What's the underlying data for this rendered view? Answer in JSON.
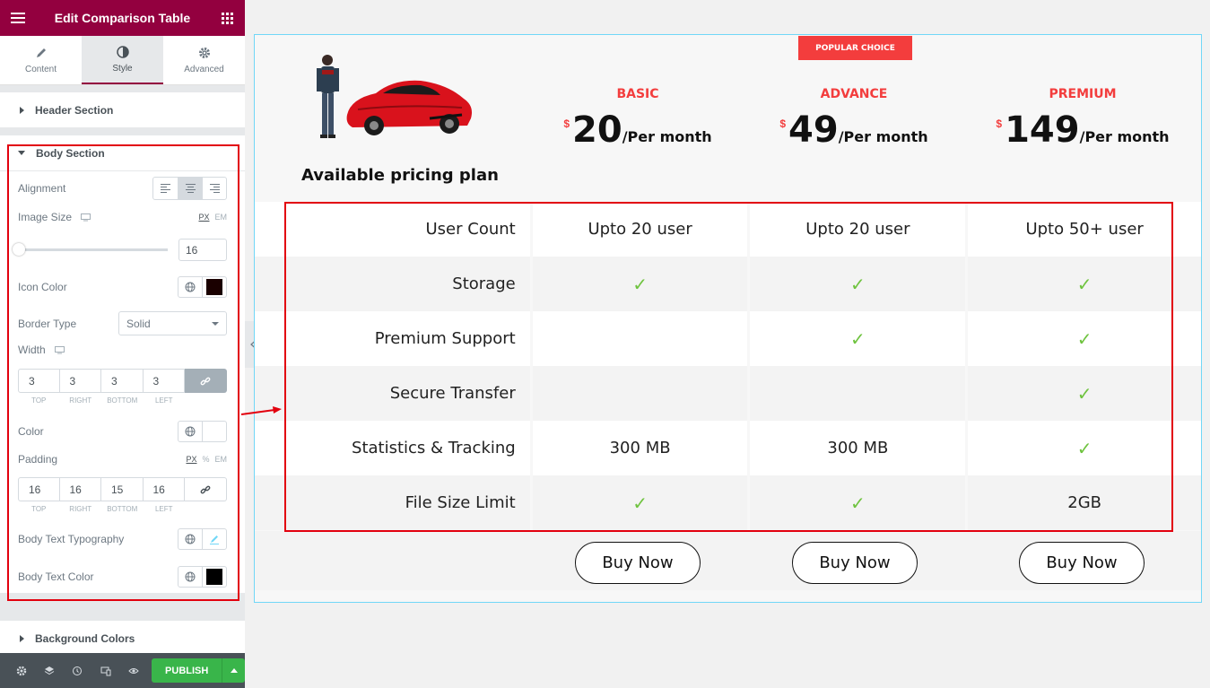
{
  "sidebar": {
    "title": "Edit Comparison Table",
    "tabs": [
      {
        "label": "Content"
      },
      {
        "label": "Style"
      },
      {
        "label": "Advanced"
      }
    ],
    "header_section": "Header Section",
    "body_section": "Body Section",
    "alignment_label": "Alignment",
    "image_size_label": "Image Size",
    "image_size_units": [
      "PX",
      "EM"
    ],
    "image_size_value": "16",
    "icon_color_label": "Icon Color",
    "icon_color": "#1a0000",
    "border_type_label": "Border Type",
    "border_type_value": "Solid",
    "width_label": "Width",
    "width_values": [
      "3",
      "3",
      "3",
      "3"
    ],
    "dim_labels": [
      "TOP",
      "RIGHT",
      "BOTTOM",
      "LEFT"
    ],
    "color_label": "Color",
    "padding_label": "Padding",
    "padding_units": [
      "PX",
      "%",
      "EM"
    ],
    "padding_values": [
      "16",
      "16",
      "15",
      "16"
    ],
    "body_text_typography_label": "Body Text Typography",
    "body_text_color_label": "Body Text Color",
    "body_text_color": "#000000",
    "background_colors": "Background Colors",
    "publish": "PUBLISH"
  },
  "table": {
    "badge": "POPULAR CHOICE",
    "heading": "Available pricing plan",
    "plans": [
      {
        "name": "BASIC",
        "currency": "$",
        "amount": "20",
        "period": "/Per month"
      },
      {
        "name": "ADVANCE",
        "currency": "$",
        "amount": "49",
        "period": "/Per month"
      },
      {
        "name": "PREMIUM",
        "currency": "$",
        "amount": "149",
        "period": "/Per month"
      }
    ],
    "rows": [
      {
        "feature": "User Count",
        "values": [
          "Upto 20 user",
          "Upto 20 user",
          "Upto 50+ user"
        ]
      },
      {
        "feature": "Storage",
        "values": [
          "check",
          "check",
          "check"
        ]
      },
      {
        "feature": "Premium Support",
        "values": [
          "",
          "check",
          "check"
        ]
      },
      {
        "feature": "Secure Transfer",
        "values": [
          "",
          "",
          "check"
        ]
      },
      {
        "feature": "Statistics & Tracking",
        "values": [
          "300 MB",
          "300 MB",
          "check"
        ]
      },
      {
        "feature": "File Size Limit",
        "values": [
          "check",
          "check",
          "2GB"
        ]
      }
    ],
    "buy_label": "Buy Now",
    "check_glyph": "✓",
    "colors": {
      "accent": "#f33d3d",
      "check": "#6ec33e",
      "brand": "#93003f",
      "publish": "#39b54a"
    }
  }
}
